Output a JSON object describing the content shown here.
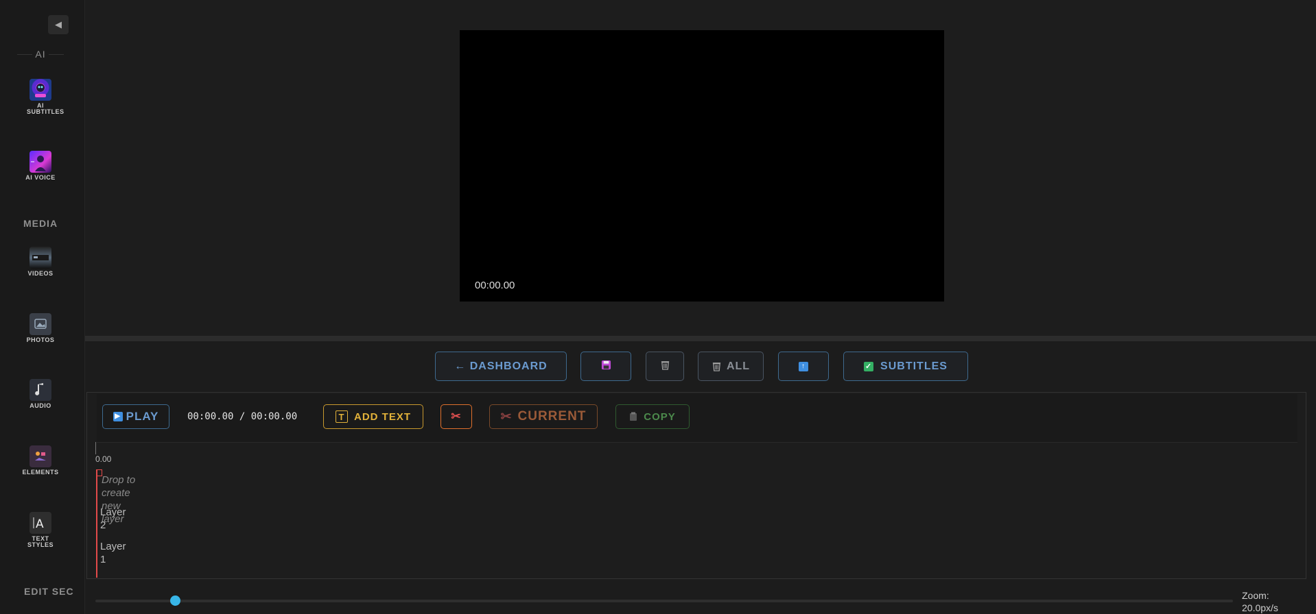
{
  "sidebar": {
    "collapse_glyph": "◀",
    "sections": {
      "ai": "AI",
      "media": "MEDIA",
      "edit": "EDIT SEC"
    },
    "items": [
      {
        "label": "AI SUBTITLES",
        "icon": "ai-subtitles-icon"
      },
      {
        "label": "AI VOICE",
        "icon": "ai-voice-icon"
      },
      {
        "label": "VIDEOS",
        "icon": "videos-icon"
      },
      {
        "label": "PHOTOS",
        "icon": "photos-icon"
      },
      {
        "label": "AUDIO",
        "icon": "audio-icon"
      },
      {
        "label": "ELEMENTS",
        "icon": "elements-icon"
      },
      {
        "label": "TEXT STYLES",
        "icon": "text-styles-icon"
      }
    ]
  },
  "preview": {
    "time": "00:00.00"
  },
  "toolbar": {
    "dashboard_label": "← DASHBOARD",
    "all_label": "ALL",
    "subtitles_label": "SUBTITLES"
  },
  "timeline": {
    "play_label": "PLAY",
    "time_display": "00:00.00 / 00:00.00",
    "add_text_label": "ADD TEXT",
    "current_label": "CURRENT",
    "copy_label": "COPY",
    "ruler_start": "0.00",
    "drop_hint": "Drop to create new layer",
    "layers": [
      "Layer 2",
      "Layer 1"
    ]
  },
  "zoom": {
    "label": "Zoom: 20.0px/s",
    "value_fraction": 0.07
  },
  "colors": {
    "accent_blue": "#6b9bd0",
    "add_text_yellow": "#e2b23a",
    "cut_orange": "#e0702c",
    "copy_green": "#4c8a4c",
    "playhead_red": "#e34a4a",
    "slider_thumb": "#38b6e8"
  }
}
